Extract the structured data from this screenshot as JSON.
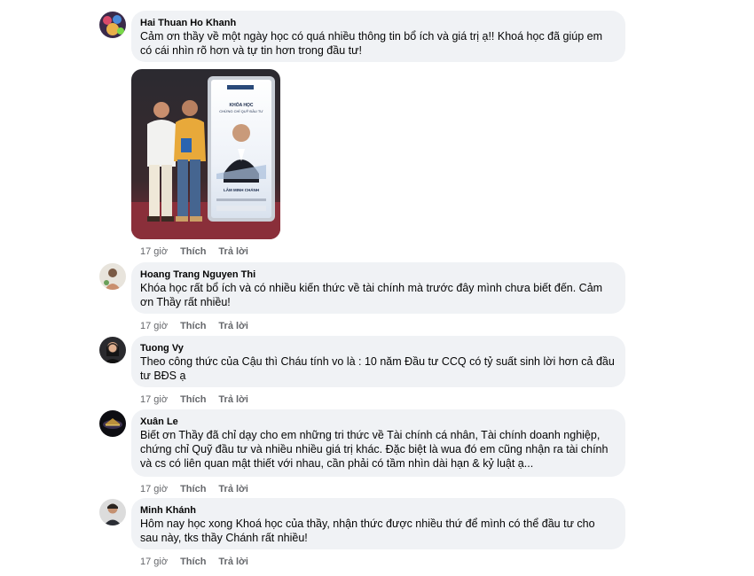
{
  "comments": [
    {
      "author": "Hai Thuan Ho Khanh",
      "text": "Cảm ơn thầy về một ngày học có quá nhiều thông tin bổ ích và giá trị ạ!! Khoá học đã giúp em có cái nhìn rõ hơn và tự tin hơn trong đầu tư!",
      "time": "17 giờ",
      "like": "Thích",
      "reply": "Trả lời"
    },
    {
      "author": "Hoang Trang Nguyen Thi",
      "text": "Khóa học rất bổ ích và có nhiều kiến thức về tài chính mà trước đây mình chưa biết đến. Cảm ơn Thầy rất nhiều!",
      "time": "17 giờ",
      "like": "Thích",
      "reply": "Trả lời"
    },
    {
      "author": "Tuong Vy",
      "text": "Theo công thức của Cậu thì Cháu tính vo là : 10 năm Đầu tư CCQ có tỷ suất sinh lời hơn cả đầu tư BĐS ạ",
      "time": "17 giờ",
      "like": "Thích",
      "reply": "Trả lời"
    },
    {
      "author": "Xuân Le",
      "text": "Biết ơn Thầy đã chỉ dạy cho em những tri thức về Tài chính cá nhân, Tài chính doanh nghiệp, chứng chỉ Quỹ đầu tư và nhiều nhiều giá trị khác. Đặc biệt là wua đó em cũng nhận ra tài chính và cs có liên quan mật thiết với nhau, cần phải có tầm nhìn dài hạn & kỷ luật ạ...",
      "time": "17 giờ",
      "like": "Thích",
      "reply": "Trả lời"
    },
    {
      "author": "Minh Khánh",
      "text": "Hôm nay học xong Khoá học của thầy, nhận thức được nhiều thứ để mình có thể đầu tư cho sau này, tks thầy Chánh rất nhiều!",
      "time": "17 giờ",
      "like": "Thích",
      "reply": "Trả lời"
    }
  ],
  "photo": {
    "banner_line1": "KHÓA HỌC",
    "banner_line2": "CHỨNG CHỈ QUỸ ĐẦU TƯ",
    "banner_name": "LÂM MINH CHÁNH"
  },
  "colors": {
    "bubble": "#f0f2f5",
    "meta": "#65676b",
    "text": "#050505"
  }
}
